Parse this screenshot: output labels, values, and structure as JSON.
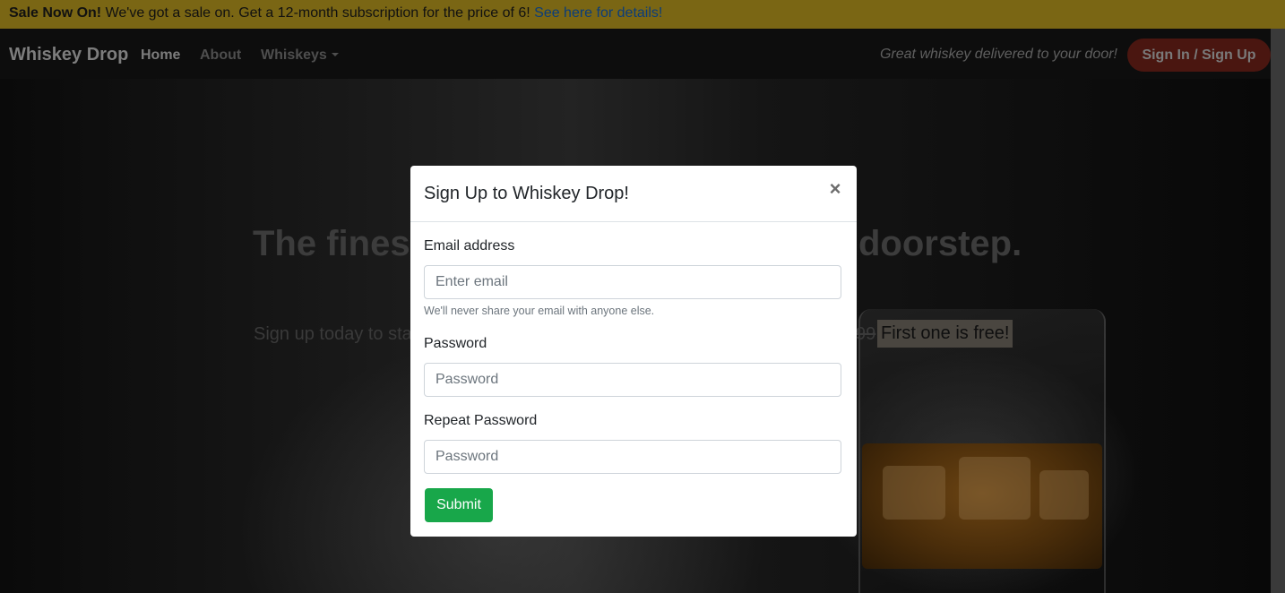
{
  "sale_banner": {
    "bold_text": "Sale Now On!",
    "text": " We've got a sale on. Get a 12-month subscription for the price of 6! ",
    "link_text": "See here for details!"
  },
  "navbar": {
    "brand": "Whiskey Drop",
    "links": [
      {
        "label": "Home"
      },
      {
        "label": "About"
      },
      {
        "label": "Whiskeys"
      }
    ],
    "tagline": "Great whiskey delivered to your door!",
    "signin_label": "Sign In / Sign Up"
  },
  "hero": {
    "title_left": "The finest",
    "title_right": "doorstep.",
    "subtitle_left": "Sign up today to sta",
    "price_fragment": "99",
    "free_badge": "First one is free!"
  },
  "modal": {
    "title": "Sign Up to Whiskey Drop!",
    "close_symbol": "×",
    "email": {
      "label": "Email address",
      "placeholder": "Enter email",
      "help": "We'll never share your email with anyone else."
    },
    "password": {
      "label": "Password",
      "placeholder": "Password"
    },
    "repeat_password": {
      "label": "Repeat Password",
      "placeholder": "Password"
    },
    "submit_label": "Submit"
  },
  "colors": {
    "sale_banner_bg": "#7a6614",
    "signin_button_bg": "#4a1610",
    "submit_button_bg": "#18a74a",
    "link_color": "#0b3d7a"
  },
  "icons": {
    "close": "close-icon",
    "dropdown": "chevron-down-icon"
  }
}
